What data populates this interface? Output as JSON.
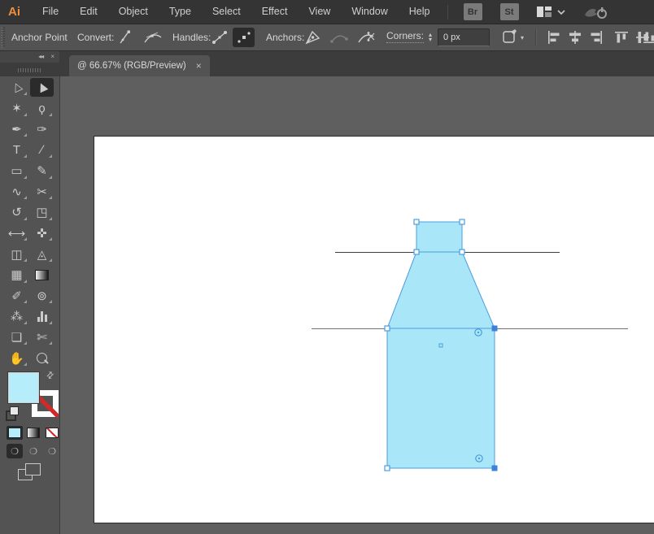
{
  "menubar": {
    "logo": "Ai",
    "items": [
      "File",
      "Edit",
      "Object",
      "Type",
      "Select",
      "Effect",
      "View",
      "Window",
      "Help"
    ],
    "bridge_button": "Br",
    "stock_button": "St"
  },
  "controlbar": {
    "title": "Anchor Point",
    "convert_label": "Convert:",
    "handles_label": "Handles:",
    "anchors_label": "Anchors:",
    "corners_label": "Corners:",
    "corners_value": "0 px",
    "stepper_up": "▴",
    "stepper_down": "▾",
    "select_chevron": "▾"
  },
  "panel_header": {
    "collapse_icon": "◂◂",
    "close_icon": "×"
  },
  "tab": {
    "title": "@ 66.67% (RGB/Preview)",
    "close_icon": "×"
  },
  "tools": [
    {
      "name": "selection-tool",
      "glyph": "▷"
    },
    {
      "name": "direct-selection-tool",
      "glyph": "▶",
      "active": true
    },
    {
      "name": "magic-wand-tool",
      "glyph": "✶"
    },
    {
      "name": "lasso-tool",
      "glyph": "ϙ"
    },
    {
      "name": "pen-tool",
      "glyph": "✒"
    },
    {
      "name": "curvature-tool",
      "glyph": "✑"
    },
    {
      "name": "type-tool",
      "glyph": "T"
    },
    {
      "name": "line-segment-tool",
      "glyph": "∕"
    },
    {
      "name": "rectangle-tool",
      "glyph": "▭"
    },
    {
      "name": "paintbrush-tool",
      "glyph": "✎"
    },
    {
      "name": "shaper-tool",
      "glyph": "∿"
    },
    {
      "name": "scissors-tool",
      "glyph": "✂"
    },
    {
      "name": "rotate-tool",
      "glyph": "↺"
    },
    {
      "name": "scale-tool",
      "glyph": "◳"
    },
    {
      "name": "width-tool",
      "glyph": "⟷"
    },
    {
      "name": "puppet-warp-tool",
      "glyph": "✜"
    },
    {
      "name": "shape-builder-tool",
      "glyph": "◫"
    },
    {
      "name": "perspective-grid-tool",
      "glyph": "◬"
    },
    {
      "name": "mesh-tool",
      "glyph": "▦"
    },
    {
      "name": "gradient-tool",
      "glyph": ""
    },
    {
      "name": "eyedropper-tool",
      "glyph": "✐"
    },
    {
      "name": "blend-tool",
      "glyph": "⊚"
    },
    {
      "name": "symbol-sprayer-tool",
      "glyph": "⁂"
    },
    {
      "name": "column-graph-tool",
      "glyph": ""
    },
    {
      "name": "artboard-tool",
      "glyph": "❏"
    },
    {
      "name": "slice-tool",
      "glyph": "✄"
    },
    {
      "name": "hand-tool",
      "glyph": "✋"
    },
    {
      "name": "zoom-tool",
      "glyph": ""
    }
  ],
  "swatches": {
    "fill_color": "#B5EDFA",
    "stroke_style": "none",
    "swap_icon": "⇄",
    "drawing_mode_glyph": "❍"
  },
  "artwork": {
    "description": "bottle-shaped path built from neck rectangle, tapered trapezoid and body rectangle, intersected by two horizontal guide lines",
    "zoom_level": "66.67%",
    "color_mode": "RGB/Preview",
    "shape_fill": "#A9E7F8",
    "selection_blue": "#4A9CDE",
    "selected_anchor_fill": "#3B82D8"
  },
  "colors": {
    "menubar_bg": "#343434",
    "panel_bg": "#535353",
    "pasteboard_bg": "#5F5F5F",
    "artboard_bg": "#FFFFFF",
    "none_red": "#D02A2A",
    "logo_orange": "#EF8E38"
  }
}
